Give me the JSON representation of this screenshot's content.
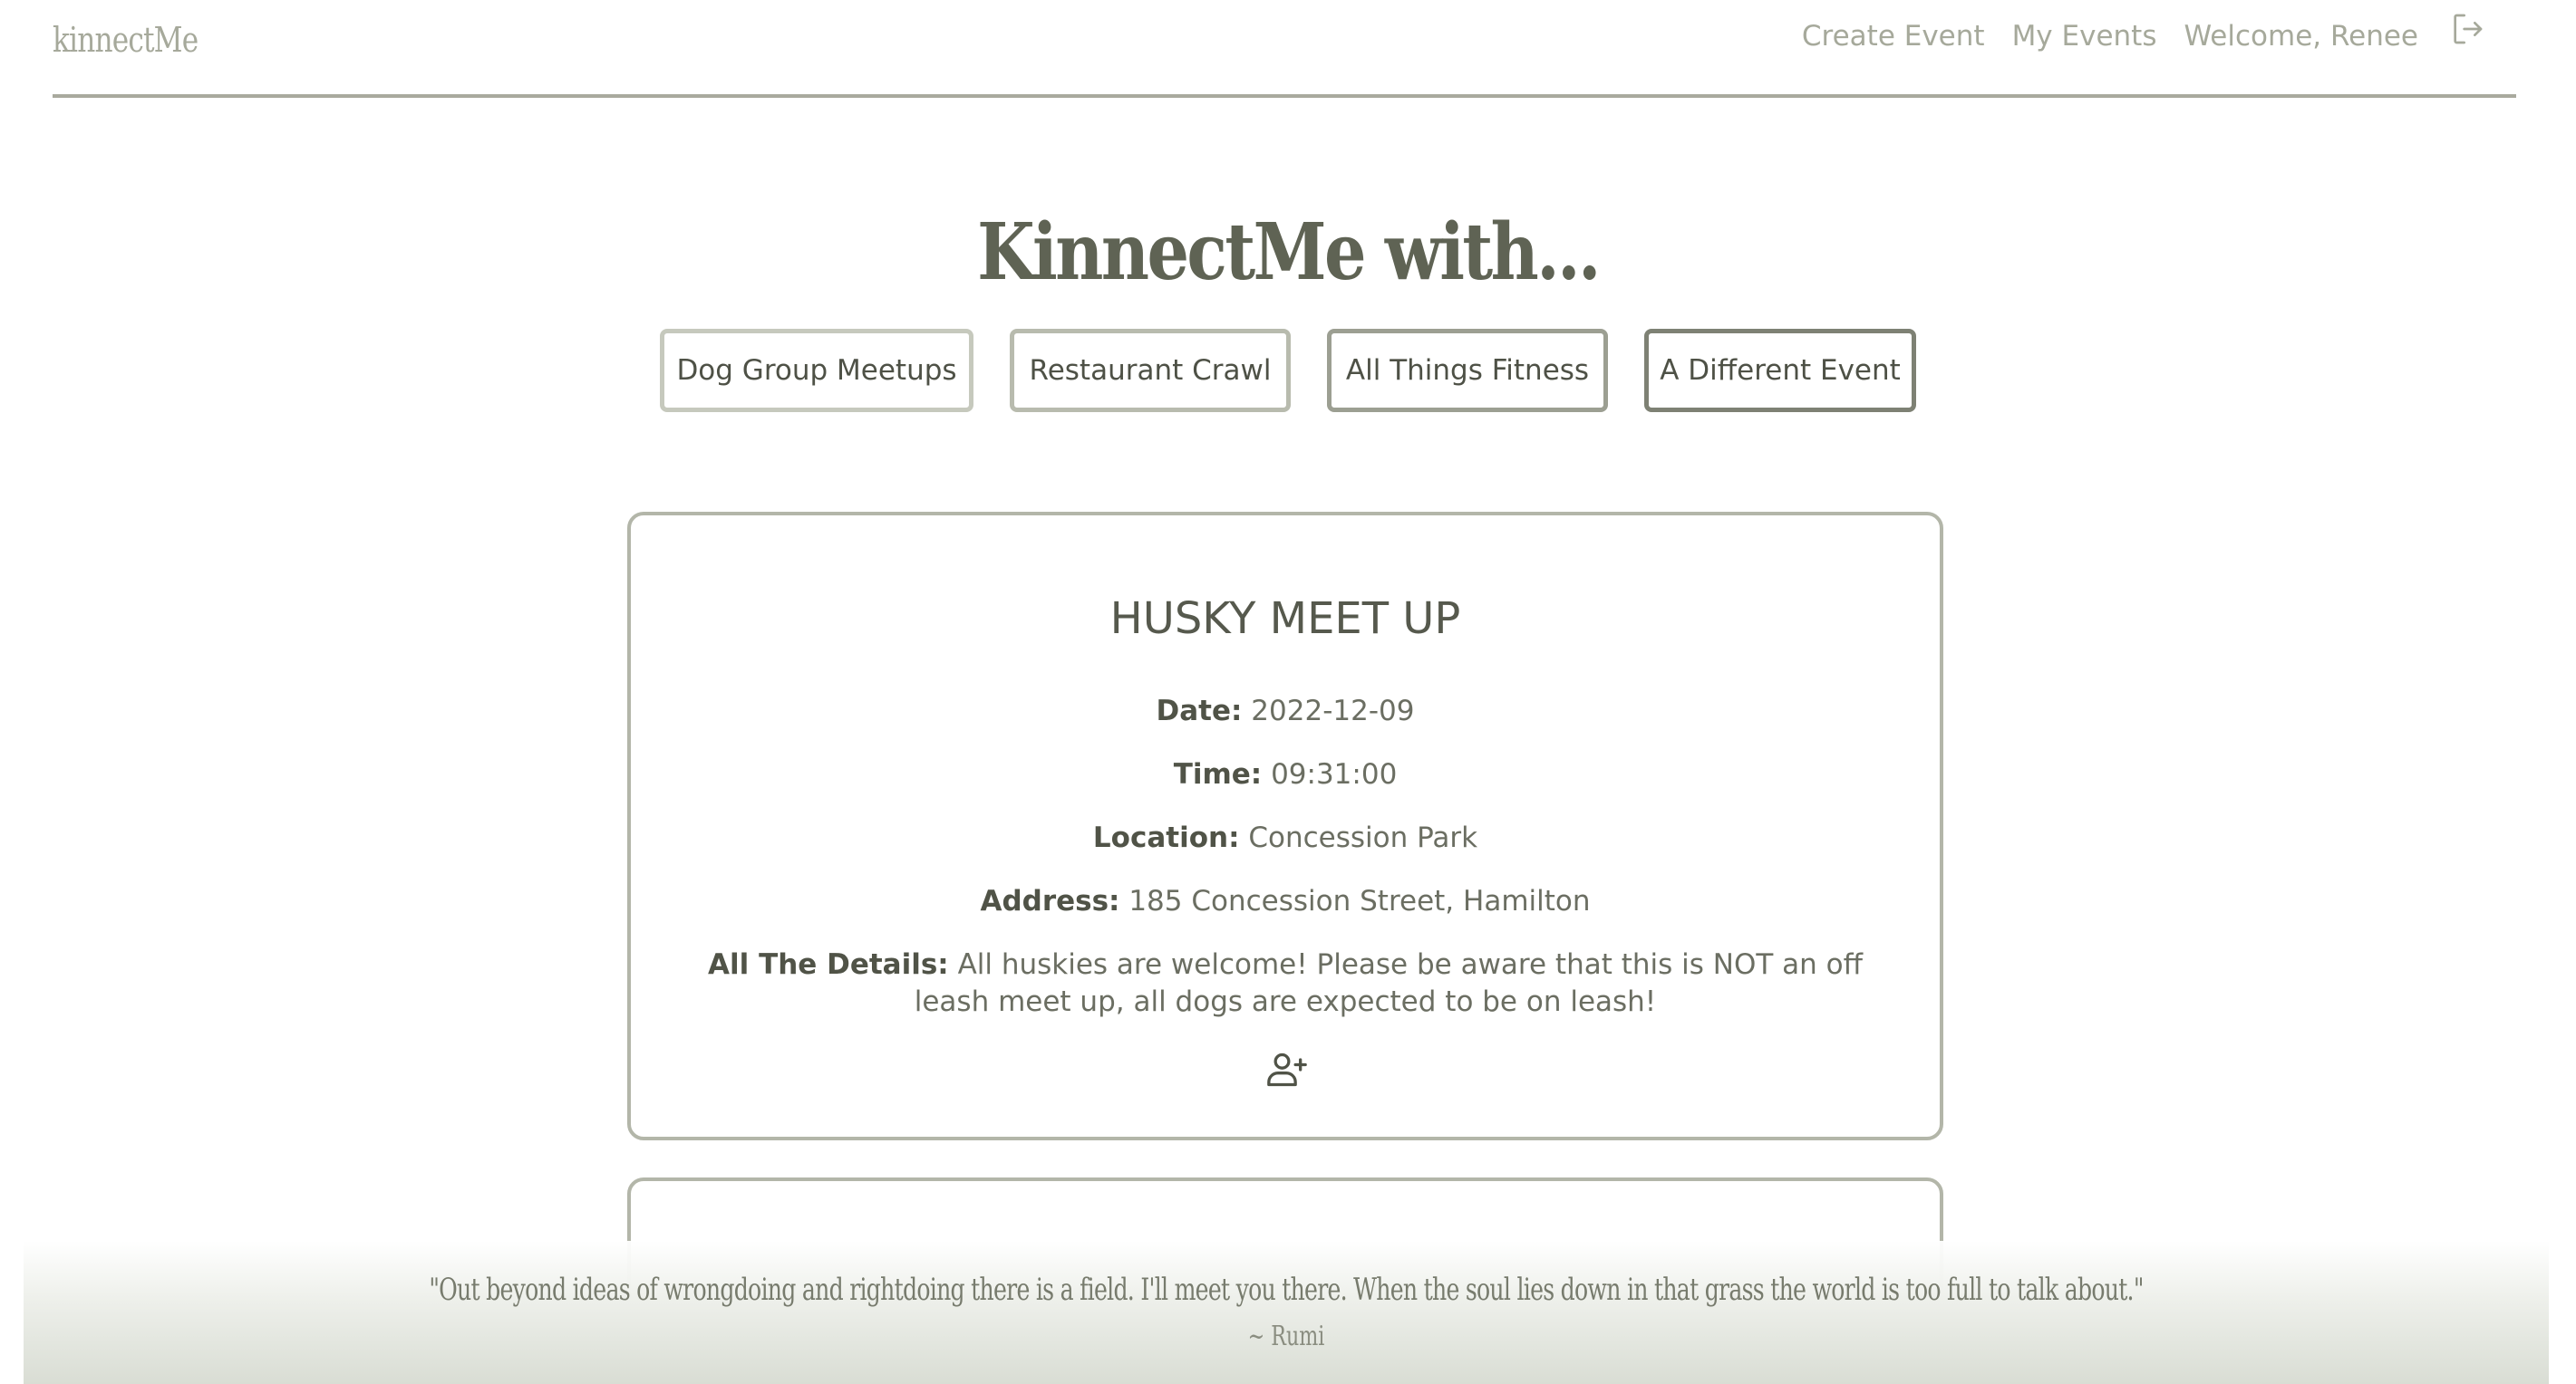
{
  "navbar": {
    "brand": "kinnectMe",
    "links": {
      "create_event": "Create Event",
      "my_events": "My Events",
      "welcome": "Welcome, Renee"
    },
    "logout_icon": "logout-icon"
  },
  "hero": {
    "title": "KinnectMe with..."
  },
  "categories": [
    {
      "label": "Dog Group Meetups"
    },
    {
      "label": "Restaurant Crawl"
    },
    {
      "label": "All Things Fitness"
    },
    {
      "label": "A Different Event"
    }
  ],
  "event": {
    "title": "HUSKY MEET UP",
    "date_label": "Date:",
    "date": "2022-12-09",
    "time_label": "Time:",
    "time": "09:31:00",
    "location_label": "Location:",
    "location": "Concession Park",
    "address_label": "Address:",
    "address": "185 Concession Street, Hamilton",
    "details_label": "All The Details:",
    "details": "All huskies are welcome! Please be aware that this is NOT an off leash meet up, all dogs are expected to be on leash!",
    "join_icon": "add-user-icon"
  },
  "footer": {
    "quote": "\"Out beyond ideas of wrongdoing and rightdoing there is a field. I'll meet you there. When the soul lies down in that grass the world is too full to talk about.\"",
    "author": "~ Rumi"
  },
  "colors": {
    "text_primary": "#5b5e52",
    "nav_text": "#a6a99b",
    "border": "#b3b6a9"
  }
}
